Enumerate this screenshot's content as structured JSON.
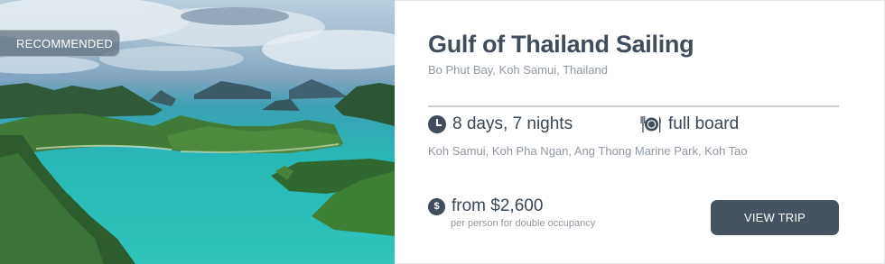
{
  "badge": {
    "label": "RECOMMENDED"
  },
  "trip": {
    "title": "Gulf of Thailand Sailing",
    "location": "Bo Phut Bay, Koh Samui, Thailand",
    "duration": "8 days, 7 nights",
    "meal_plan": "full board",
    "ports": "Koh Samui, Koh Pha Ngan, Ang Thong Marine Park, Koh Tao",
    "price": "from $2,600",
    "price_note": "per person for double occupancy",
    "currency_symbol": "$"
  },
  "actions": {
    "view_trip_label": "VIEW TRIP"
  },
  "icons": {
    "duration": "clock-icon",
    "meals": "plate-cutlery-icon",
    "price": "dollar-icon"
  },
  "colors": {
    "accent": "#465462",
    "title": "#3f4d5c",
    "muted": "#8f98a2"
  }
}
